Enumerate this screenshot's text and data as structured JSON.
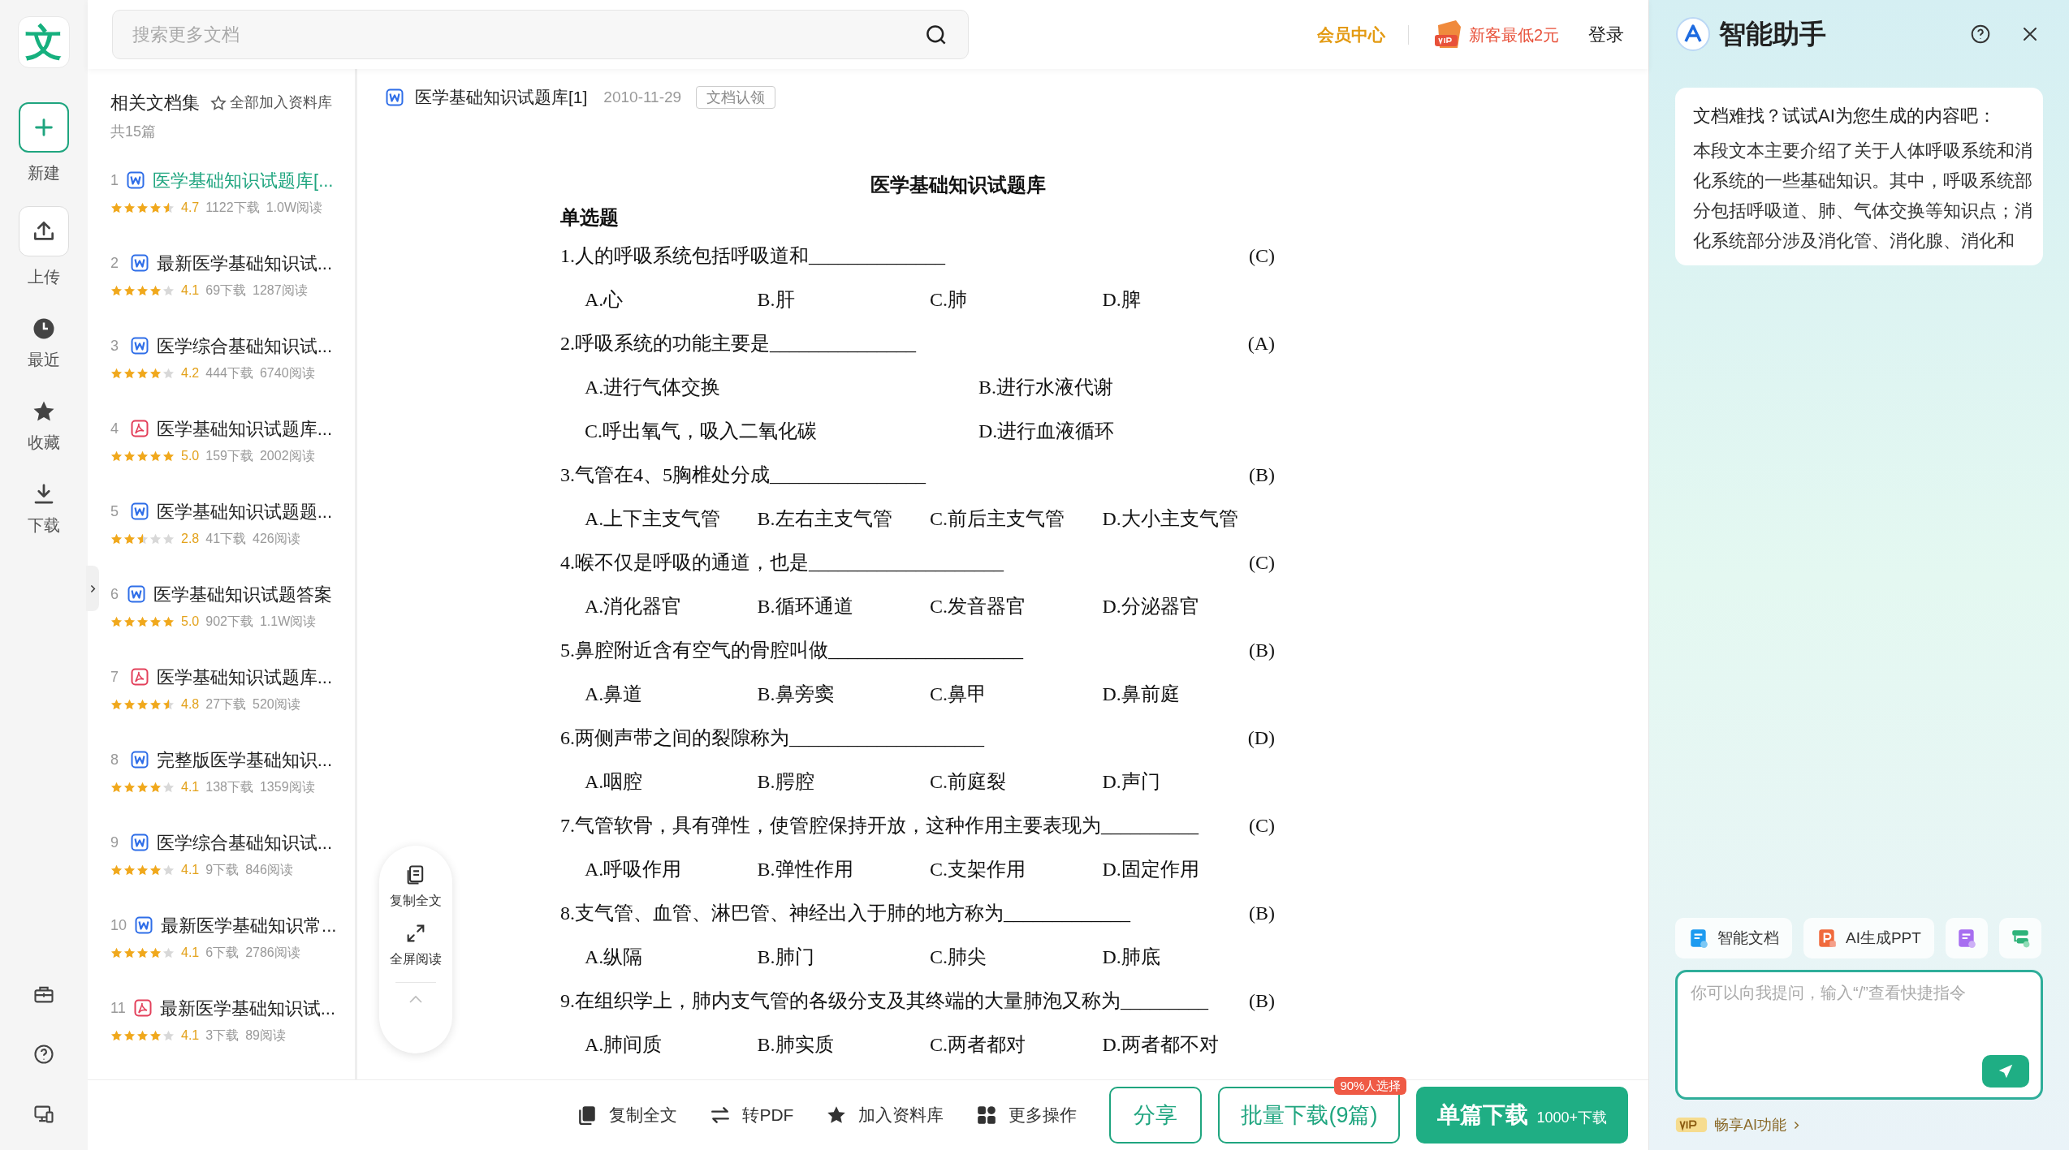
{
  "rail": {
    "logo": "文",
    "items": [
      {
        "kind": "new",
        "label": "新建"
      },
      {
        "kind": "upload",
        "label": "上传"
      },
      {
        "kind": "recent",
        "label": "最近"
      },
      {
        "kind": "star",
        "label": "收藏"
      },
      {
        "kind": "download",
        "label": "下载"
      }
    ]
  },
  "search": {
    "placeholder": "搜索更多文档"
  },
  "top_links": {
    "member": "会员中心",
    "promo": "新客最低2元",
    "login": "登录"
  },
  "doc_list": {
    "title": "相关文档集",
    "add_all": "全部加入资料库",
    "count": "共15篇",
    "items": [
      {
        "index": "1",
        "kind": "word",
        "title": "医学基础知识试题库[...",
        "selected": true,
        "stars": 4.5,
        "rating": "4.7",
        "downloads": "1122下载",
        "reads": "1.0W阅读"
      },
      {
        "index": "2",
        "kind": "word",
        "title": "最新医学基础知识试...",
        "selected": false,
        "stars": 4,
        "rating": "4.1",
        "downloads": "69下载",
        "reads": "1287阅读"
      },
      {
        "index": "3",
        "kind": "word",
        "title": "医学综合基础知识试...",
        "selected": false,
        "stars": 4,
        "rating": "4.2",
        "downloads": "444下载",
        "reads": "6740阅读"
      },
      {
        "index": "4",
        "kind": "pdf",
        "title": "医学基础知识试题库...",
        "selected": false,
        "stars": 5,
        "rating": "5.0",
        "downloads": "159下载",
        "reads": "2002阅读"
      },
      {
        "index": "5",
        "kind": "word",
        "title": "医学基础知识试题题...",
        "selected": false,
        "stars": 2.5,
        "rating": "2.8",
        "downloads": "41下载",
        "reads": "426阅读"
      },
      {
        "index": "6",
        "kind": "word",
        "title": "医学基础知识试题答案",
        "selected": false,
        "stars": 5,
        "rating": "5.0",
        "downloads": "902下载",
        "reads": "1.1W阅读"
      },
      {
        "index": "7",
        "kind": "pdf",
        "title": "医学基础知识试题库...",
        "selected": false,
        "stars": 4.5,
        "rating": "4.8",
        "downloads": "27下载",
        "reads": "520阅读"
      },
      {
        "index": "8",
        "kind": "word",
        "title": "完整版医学基础知识...",
        "selected": false,
        "stars": 4,
        "rating": "4.1",
        "downloads": "138下载",
        "reads": "1359阅读"
      },
      {
        "index": "9",
        "kind": "word",
        "title": "医学综合基础知识试...",
        "selected": false,
        "stars": 4,
        "rating": "4.1",
        "downloads": "9下载",
        "reads": "846阅读"
      },
      {
        "index": "10",
        "kind": "word",
        "title": "最新医学基础知识常...",
        "selected": false,
        "stars": 4,
        "rating": "4.1",
        "downloads": "6下载",
        "reads": "2786阅读"
      },
      {
        "index": "11",
        "kind": "pdf",
        "title": "最新医学基础知识试...",
        "selected": false,
        "stars": 4,
        "rating": "4.1",
        "downloads": "3下载",
        "reads": "89阅读"
      }
    ]
  },
  "document": {
    "title": "医学基础知识试题库[1]",
    "date": "2010-11-29",
    "claim": "文档认领",
    "page_title": "医学基础知识试题库",
    "section": "单选题",
    "questions": [
      {
        "kind": "four_across",
        "text": "1.人的呼吸系统包括呼吸道和______________",
        "answer": "(C)",
        "options": [
          "A.心",
          "B.肝",
          "C.肺",
          "D.脾"
        ]
      },
      {
        "kind": "two_by_two",
        "text": "2.呼吸系统的功能主要是_______________",
        "answer": "(A)",
        "options": [
          "A.进行气体交换",
          "B.进行水液代谢",
          "C.呼出氧气，吸入二氧化碳",
          "D.进行血液循环"
        ]
      },
      {
        "kind": "four_across",
        "text": "3.气管在4、5胸椎处分成________________",
        "answer": "(B)",
        "options": [
          "A.上下主支气管",
          "B.左右主支气管",
          "C.前后主支气管",
          "D.大小主支气管"
        ]
      },
      {
        "kind": "four_across",
        "text": "4.喉不仅是呼吸的通道，也是____________________",
        "answer": "(C)",
        "options": [
          "A.消化器官",
          "B.循环通道",
          "C.发音器官",
          "D.分泌器官"
        ]
      },
      {
        "kind": "four_across",
        "text": "5.鼻腔附近含有空气的骨腔叫做____________________",
        "answer": "(B)",
        "options": [
          "A.鼻道",
          "B.鼻旁窦",
          "C.鼻甲",
          "D.鼻前庭"
        ]
      },
      {
        "kind": "four_across",
        "text": "6.两侧声带之间的裂隙称为____________________",
        "answer": "(D)",
        "options": [
          "A.咽腔",
          "B.腭腔",
          "C.前庭裂",
          "D.声门"
        ]
      },
      {
        "kind": "four_across",
        "text": "7.气管软骨，具有弹性，使管腔保持开放，这种作用主要表现为__________",
        "answer": "(C)",
        "options": [
          "A.呼吸作用",
          "B.弹性作用",
          "C.支架作用",
          "D.固定作用"
        ]
      },
      {
        "kind": "four_across",
        "text": "8.支气管、血管、淋巴管、神经出入于肺的地方称为_____________",
        "answer": "(B)",
        "options": [
          "A.纵隔",
          "B.肺门",
          "C.肺尖",
          "D.肺底"
        ]
      },
      {
        "kind": "four_across",
        "text": "9.在组织学上，肺内支气管的各级分支及其终端的大量肺泡又称为_________",
        "answer": "(B)",
        "options": [
          "A.肺间质",
          "B.肺实质",
          "C.两者都对",
          "D.两者都不对"
        ]
      }
    ]
  },
  "float_tools": [
    "复制全文",
    "全屏阅读"
  ],
  "bottom_bar": {
    "actions": [
      {
        "kind": "copy",
        "label": "复制全文"
      },
      {
        "kind": "pdf",
        "label": "转PDF"
      },
      {
        "kind": "star",
        "label": "加入资料库"
      },
      {
        "kind": "more",
        "label": "更多操作"
      }
    ],
    "share": "分享",
    "batch": "批量下载(9篇)",
    "batch_badge": "90%人选择",
    "single": "单篇下载",
    "single_note": "1000+下载"
  },
  "assistant": {
    "title": "智能助手",
    "card_title": "文档难找？试试AI为您生成的内容吧：",
    "card_body": "本段文本主要介绍了关于人体呼吸系统和消化系统的一些基础知识。其中，呼吸系统部分包括呼吸道、肺、气体交换等知识点；消化系统部分涉及消化管、消化腺、消化和",
    "quick_actions": [
      {
        "kind": "doc",
        "label": "智能文档"
      },
      {
        "kind": "ppt",
        "label": "AI生成PPT"
      },
      {
        "kind": "form"
      },
      {
        "kind": "chart"
      }
    ],
    "input_placeholder": "你可以向我提问，输入“/”查看快捷指令",
    "vip": "畅享AI功能"
  }
}
